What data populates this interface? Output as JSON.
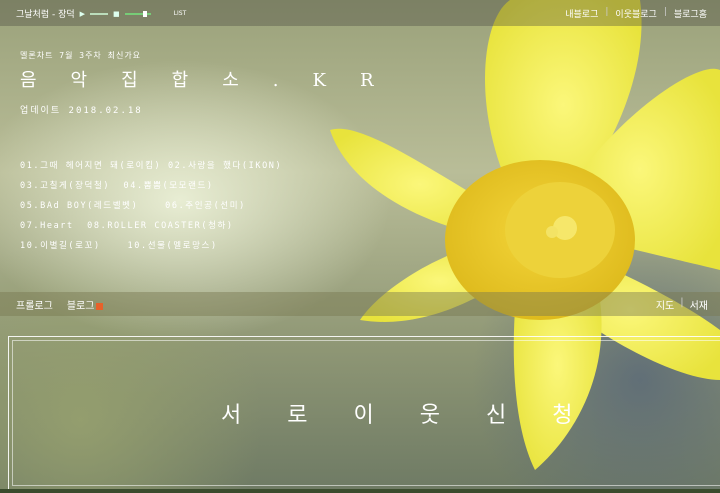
{
  "topbar": {
    "player_title": "그날처럼 - 장덕",
    "play_icon": "play-icon",
    "stop_icon": "stop-icon",
    "list_label": "LIST",
    "links": [
      "내블로그",
      "이웃블로그",
      "블로그홈"
    ]
  },
  "header": {
    "eyebrow": "멜론차트 7월 3주차 최신가요",
    "title": "음악집합소.KR",
    "update": "업데이트 2018.02.18"
  },
  "chart": {
    "lines": [
      "01.그때 헤어지면 돼(로이킴) 02.사랑을 했다(IKON)",
      "03.고칠게(장덕철)  04.뿜뿜(모모랜드)",
      "05.BAd BOY(레드벨벳)    06.주인공(선미)",
      "07.Heart  08.ROLLER COASTER(청하)",
      "10.이별길(로꼬)    10.선물(멜로망스)"
    ]
  },
  "nav": {
    "left": [
      "프롤로그",
      "블로그"
    ],
    "right": [
      "지도",
      "서재"
    ]
  },
  "panel": {
    "neighbor_label": "서로이웃신청"
  },
  "colors": {
    "petal": "#f2ee4a",
    "trumpet": "#e6c81e",
    "rss": "#e7612a"
  }
}
